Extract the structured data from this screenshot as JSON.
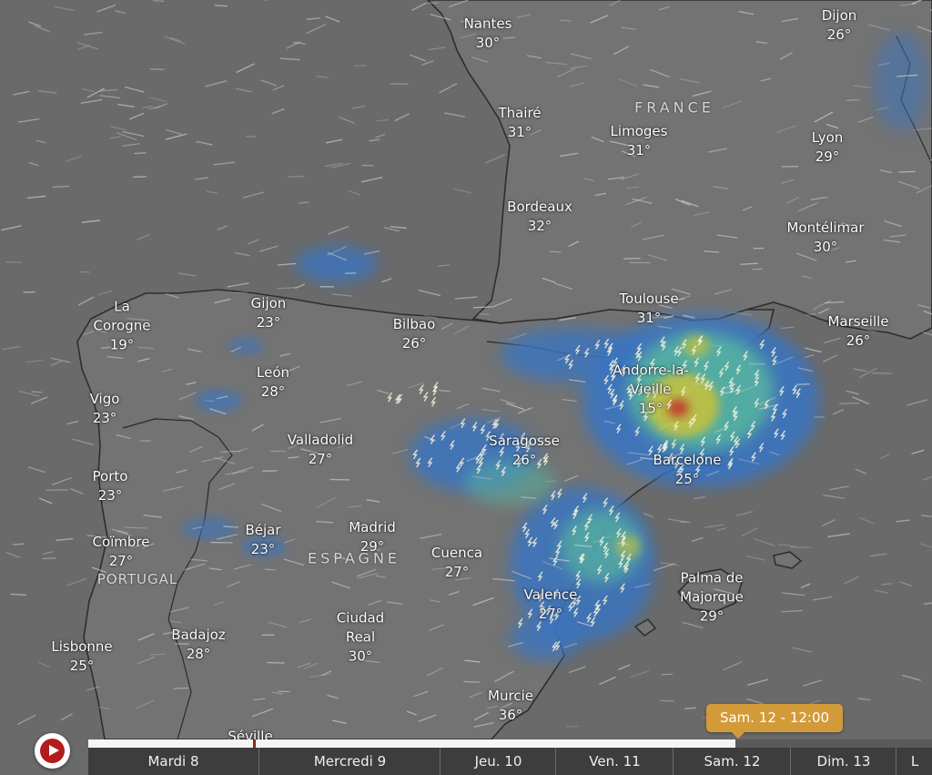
{
  "country_labels": [
    {
      "id": "france",
      "text": "FRANCE"
    },
    {
      "id": "espagne",
      "text": "ESPAGNE"
    },
    {
      "id": "portugal",
      "text": "PORTUGAL"
    }
  ],
  "cities": [
    {
      "id": "nantes",
      "name": "Nantes",
      "temp": "30°"
    },
    {
      "id": "dijon",
      "name": "Dijon",
      "temp": "26°"
    },
    {
      "id": "thaire",
      "name": "Thairé",
      "temp": "31°"
    },
    {
      "id": "limoges",
      "name": "Limoges",
      "temp": "31°"
    },
    {
      "id": "lyon",
      "name": "Lyon",
      "temp": "29°"
    },
    {
      "id": "bordeaux",
      "name": "Bordeaux",
      "temp": "32°"
    },
    {
      "id": "montelimar",
      "name": "Montélimar",
      "temp": "30°"
    },
    {
      "id": "toulouse",
      "name": "Toulouse",
      "temp": "31°"
    },
    {
      "id": "marseille",
      "name": "Marseille",
      "temp": "26°"
    },
    {
      "id": "la-corogne",
      "name": "La\nCorogne",
      "temp": "19°"
    },
    {
      "id": "gijon",
      "name": "Gijon",
      "temp": "23°"
    },
    {
      "id": "bilbao",
      "name": "Bilbao",
      "temp": "26°"
    },
    {
      "id": "leon",
      "name": "León",
      "temp": "28°"
    },
    {
      "id": "vigo",
      "name": "Vigo",
      "temp": "23°"
    },
    {
      "id": "andorre",
      "name": "Andorre-la-\nVieille",
      "temp": "15°"
    },
    {
      "id": "valladolid",
      "name": "Valladolid",
      "temp": "27°"
    },
    {
      "id": "saragosse",
      "name": "Saragosse",
      "temp": "26°"
    },
    {
      "id": "barcelone",
      "name": "Barcelone",
      "temp": "25°"
    },
    {
      "id": "porto",
      "name": "Porto",
      "temp": "23°"
    },
    {
      "id": "bejar",
      "name": "Béjar",
      "temp": "23°"
    },
    {
      "id": "madrid",
      "name": "Madrid",
      "temp": "29°"
    },
    {
      "id": "coimbre",
      "name": "Coïmbre",
      "temp": "27°"
    },
    {
      "id": "cuenca",
      "name": "Cuenca",
      "temp": "27°"
    },
    {
      "id": "palma",
      "name": "Palma de\nMajorque",
      "temp": "29°"
    },
    {
      "id": "valence",
      "name": "Valence",
      "temp": "27°"
    },
    {
      "id": "ciudad-real",
      "name": "Ciudad\nReal",
      "temp": "30°"
    },
    {
      "id": "badajoz",
      "name": "Badajoz",
      "temp": "28°"
    },
    {
      "id": "lisbonne",
      "name": "Lisbonne",
      "temp": "25°"
    },
    {
      "id": "murcie",
      "name": "Murcie",
      "temp": "36°"
    },
    {
      "id": "seville",
      "name": "Séville",
      "temp": ""
    }
  ],
  "timeline": {
    "days": [
      "Mardi 8",
      "Mercredi 9",
      "Jeu. 10",
      "Ven. 11",
      "Sam. 12",
      "Dim. 13",
      "L"
    ],
    "current_label": "Sam. 12 - 12:00",
    "progress_fraction": 0.767
  },
  "colors": {
    "map_base": "#6e6e6e",
    "sea": "#6b6b6b",
    "land": "#727272",
    "border": "#2c2c2c",
    "precip_light": "#3a74c0",
    "precip_mid": "#56b6a0",
    "precip_high": "#c9c23a",
    "precip_max": "#c0392b",
    "tooltip": "#d39a3a",
    "play": "#b21c1c"
  },
  "icons": [
    "play-icon",
    "lightning-icon",
    "wind-streak"
  ]
}
